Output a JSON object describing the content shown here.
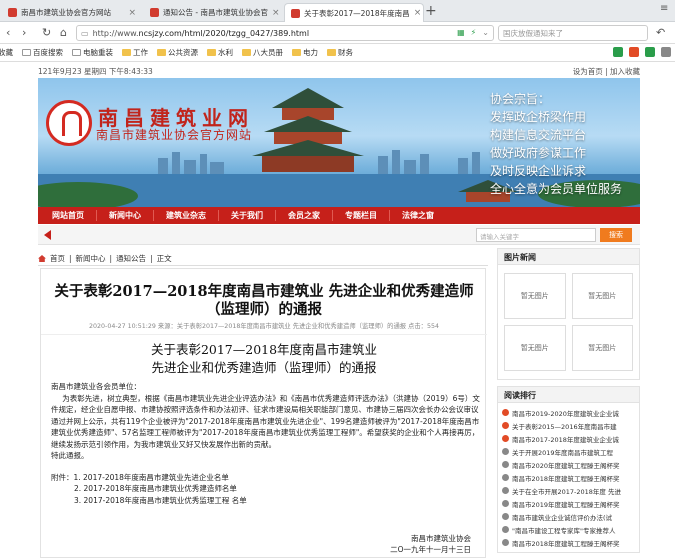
{
  "browser": {
    "tabs": [
      {
        "title": "南昌市建筑业协会官方网站",
        "active": false
      },
      {
        "title": "通知公告 - 南昌市建筑业协会官",
        "active": false
      },
      {
        "title": "关于表彰2017—2018年度南昌",
        "active": true
      }
    ],
    "url_prefix": "http://www.",
    "url_main": "ncsjzy.com/html/2020/tzgg_0427/389.html",
    "search_placeholder": "国庆放假通知来了",
    "bookmarks": [
      "收藏",
      "百度搜索",
      "电脑重装",
      "工作",
      "公共资源",
      "水利",
      "八大员册",
      "电力",
      "财务"
    ]
  },
  "site": {
    "date_line": "121年9月23 星期四 下午8:43:33",
    "top_links": "设为首页 | 加入收藏",
    "brand": "南昌建筑业网",
    "brand_sub": "南昌市建筑业协会官方网站",
    "slogan": [
      "协会宗旨：",
      "发挥政企桥梁作用",
      "构建信息交流平台",
      "做好政府参谋工作",
      "及时反映企业诉求",
      "全心全意为会员单位服务"
    ],
    "nav": [
      "网站首页",
      "新闻中心",
      "建筑业杂志",
      "关于我们",
      "会员之家",
      "专题栏目",
      "法律之窗"
    ],
    "search_placeholder": "请输入关键字",
    "search_button": "搜索",
    "breadcrumb": [
      "首页",
      "新闻中心",
      "通知公告",
      "正文"
    ]
  },
  "article": {
    "title": "关于表彰2017—2018年度南昌市建筑业 先进企业和优秀建造师（监理师）的通报",
    "meta": "2020-04-27 10:51:29   来源：关于表彰2017—2018年度南昌市建筑业 先进企业和优秀建造师（监理师）的通报   点击：554",
    "sub_line1": "关于表彰2017—2018年度南昌市建筑业",
    "sub_line2": "先进企业和优秀建造师（监理师）的通报",
    "greeting": "南昌市建筑业各会员单位：",
    "para1": "为表彰先进，树立典型，根据《南昌市建筑业先进企业评选办法》和《南昌市优秀建造师评选办法》（洪建协（2019）6号）文件规定，经企业自愿申报、市建协按照评选条件和办法初评、征求市建设局相关职能部门意见、市建协三届四次会长办公会议审议通过并网上公示，共有119个企业被评为\"2017-2018年度南昌市建筑业先进企业\"、199名建造师被评为\"2017-2018年度南昌市建筑业优秀建造师\"、57名监理工程师被评为\"2017-2018年度南昌市建筑业优秀监理工程师\"。希望获奖的企业和个人再接再厉，继续发扬示范引领作用，为我市建筑业又好又快发展作出新的贡献。",
    "para2": "特此通报。",
    "attach1": "附件：1. 2017-2018年度南昌市建筑业先进企业名单",
    "attach2": "2. 2017-2018年度南昌市建筑业优秀建造师名单",
    "attach3": "3. 2017-2018年度南昌市建筑业优秀监理工程 名单",
    "sign_org": "南昌市建筑业协会",
    "sign_date": "二O一九年十一月十三日"
  },
  "sidebar": {
    "pics_title": "图片新闻",
    "pic_label": "暂无图片",
    "rank_title": "阅读排行",
    "rank_items": [
      {
        "text": "南昌市2019-2020年度建筑业企业诚",
        "color": "red"
      },
      {
        "text": "关于表彰2015—2016年度南昌市建",
        "color": "red"
      },
      {
        "text": "南昌市2017-2018年度建筑业企业诚",
        "color": "red"
      },
      {
        "text": "关于开展2019年度南昌市建筑工程",
        "color": "gray"
      },
      {
        "text": "南昌市2020年度建筑工程滕王阁杯奖",
        "color": "gray"
      },
      {
        "text": "南昌市2018年度建筑工程滕王阁杯奖",
        "color": "gray"
      },
      {
        "text": "关于在全市开展2017-2018年度 先进",
        "color": "gray"
      },
      {
        "text": "南昌市2019年度建筑工程滕王阁杯奖",
        "color": "gray"
      },
      {
        "text": "南昌市建筑业企业诚信评价办法(试",
        "color": "gray"
      },
      {
        "text": "\"南昌市建设工程专家库\"专家推荐人",
        "color": "gray"
      },
      {
        "text": "南昌市2018年度建筑工程滕王阁杯奖",
        "color": "gray"
      }
    ]
  },
  "colors": {
    "brand_red": "#c6201a",
    "search_orange": "#f07b1e"
  }
}
